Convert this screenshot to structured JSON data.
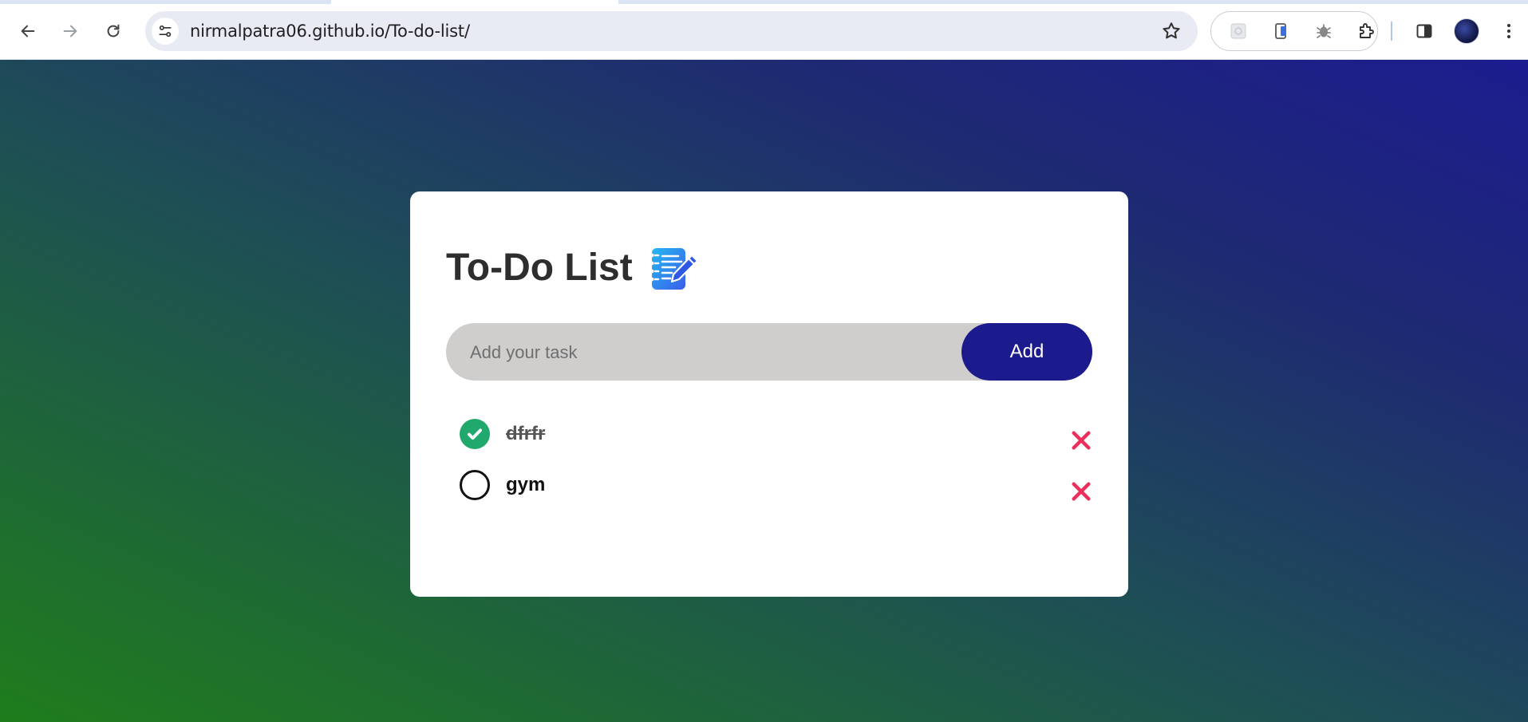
{
  "browser": {
    "url": "nirmalpatra06.github.io/To-do-list/"
  },
  "app": {
    "title": "To-Do List",
    "input_placeholder": "Add your task",
    "input_value": "",
    "add_label": "Add",
    "tasks": [
      {
        "text": "dfrfr",
        "completed": true
      },
      {
        "text": "gym",
        "completed": false
      }
    ]
  },
  "colors": {
    "accent": "#1c1b8e",
    "check_done": "#21a86c",
    "delete": "#e8305a",
    "input_bg": "#cfcecd"
  },
  "icons": {
    "title": "notepad-pencil-icon",
    "done": "check-circle-icon",
    "open": "empty-circle-icon",
    "delete": "close-x-icon"
  }
}
